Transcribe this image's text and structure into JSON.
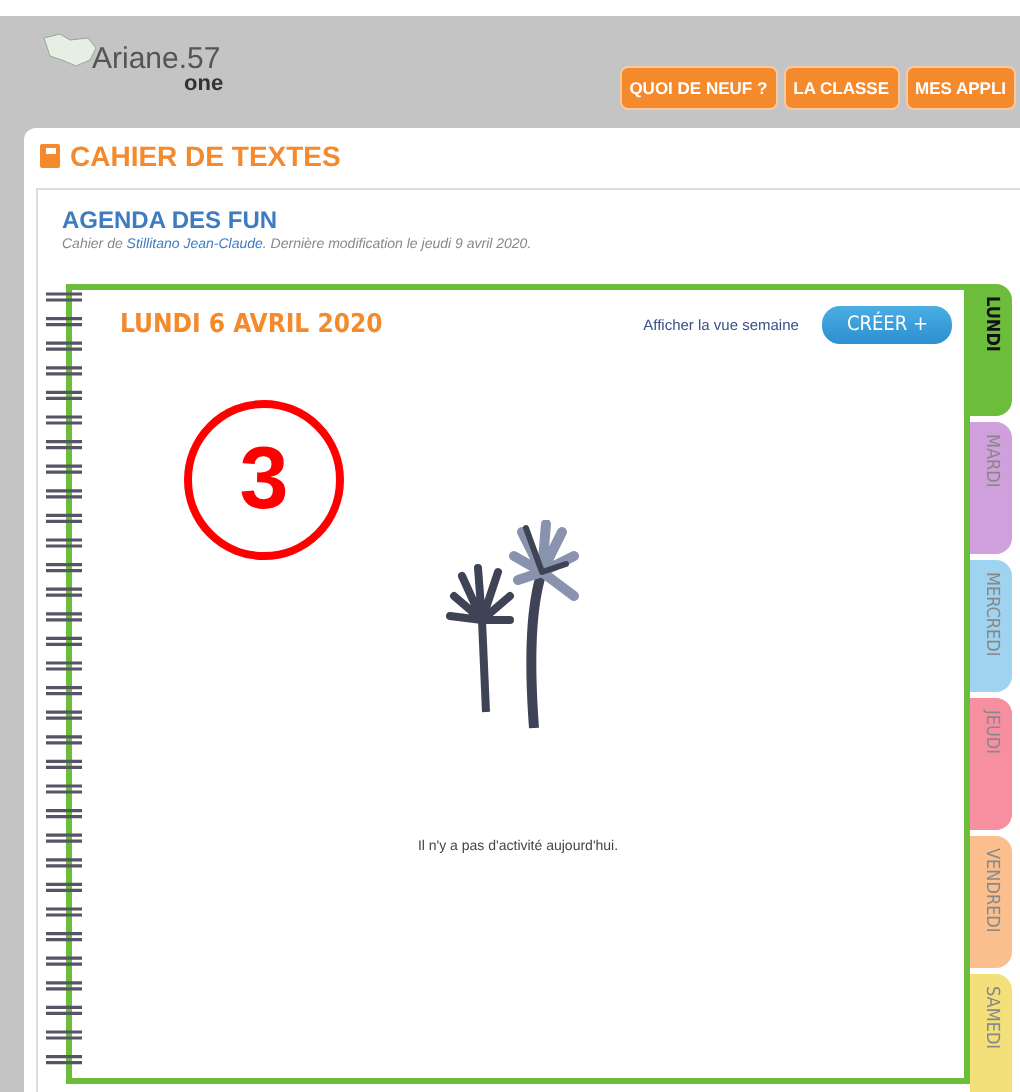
{
  "header": {
    "logo_text": "Ariane.57",
    "logo_sub": "one",
    "nav": [
      {
        "label": "QUOI DE NEUF ?"
      },
      {
        "label": "LA CLASSE"
      },
      {
        "label": "MES APPLI"
      }
    ]
  },
  "page_title": "CAHIER DE TEXTES",
  "agenda": {
    "title": "AGENDA DES FUN",
    "subtitle_before": "Cahier de ",
    "author": "Stillitano Jean-Claude",
    "subtitle_after": ". Dernière modification le jeudi 9 avril 2020."
  },
  "day": {
    "title": "LUNDI 6 AVRIL 2020",
    "week_link": "Afficher la vue semaine",
    "create_button": "CRÉER +",
    "annotation": "3",
    "empty_message": "Il n'y a pas d'activité aujourd'hui."
  },
  "day_tabs": [
    {
      "label": "LUNDI",
      "selected": true,
      "color": "#6dbd3c"
    },
    {
      "label": "MARDI",
      "selected": false,
      "color": "#cfa0dc"
    },
    {
      "label": "MERCREDI",
      "selected": false,
      "color": "#9fd3ef"
    },
    {
      "label": "JEUDI",
      "selected": false,
      "color": "#f68fa0"
    },
    {
      "label": "VENDREDI",
      "selected": false,
      "color": "#fbbf8e"
    },
    {
      "label": "SAMEDI",
      "selected": false,
      "color": "#f3e07a"
    }
  ]
}
